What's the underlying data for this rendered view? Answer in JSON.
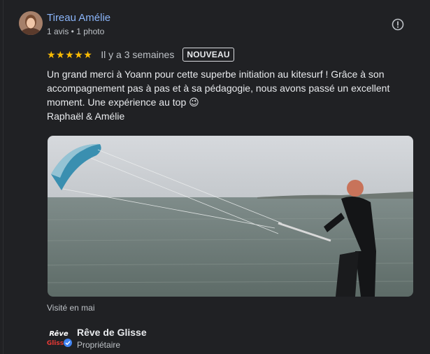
{
  "review": {
    "author": "Tireau Amélie",
    "meta": "1 avis • 1 photo",
    "stars": "★★★★★",
    "rating": 5,
    "when": "Il y a 3 semaines",
    "badge": "NOUVEAU",
    "text_line1": "Un grand merci à Yoann pour cette superbe initiation au kitesurf ! Grâce à son accompagnement pas à pas et à sa pédagogie, nous avons passé un excellent moment. Une expérience au top 😉",
    "text_line2": "Raphaël & Amélie",
    "visited": "Visité en mai"
  },
  "owner": {
    "name": "Rêve de Glisse",
    "role": "Propriétaire",
    "logo_text": "Rêve de Glisse"
  },
  "colors": {
    "link": "#8ab4f8",
    "star": "#fbbc04",
    "verified": "#4285f4"
  },
  "icons": {
    "flag": "report-flag-icon",
    "verified": "verified-check-icon"
  }
}
